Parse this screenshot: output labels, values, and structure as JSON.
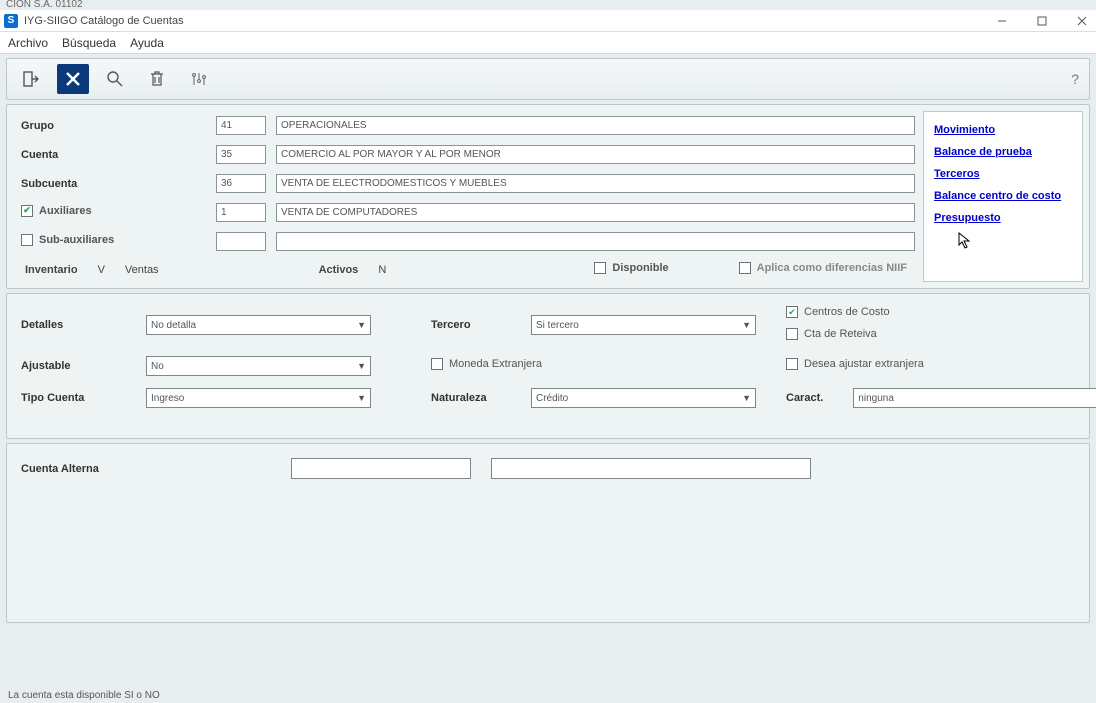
{
  "pre_title": "CION S.A.   01102",
  "window": {
    "title": "IYG-SIIGO  Catálogo de Cuentas"
  },
  "menu": {
    "archivo": "Archivo",
    "busqueda": "Búsqueda",
    "ayuda": "Ayuda"
  },
  "toolbar": {
    "help": "?"
  },
  "labels": {
    "grupo": "Grupo",
    "cuenta": "Cuenta",
    "subcuenta": "Subcuenta",
    "auxiliares": "Auxiliares",
    "subauxiliares": "Sub-auxiliares",
    "inventario": "Inventario",
    "ventas": "Ventas",
    "activos": "Activos",
    "disponible": "Disponible",
    "aplica_niif": "Aplica como diferencias NIIF",
    "detalles": "Detalles",
    "tercero": "Tercero",
    "ajustable": "Ajustable",
    "moneda_extranjera": "Moneda Extranjera",
    "tipo_cuenta": "Tipo Cuenta",
    "naturaleza": "Naturaleza",
    "caract": "Caract.",
    "centros_costo": "Centros de Costo",
    "cta_reteiva": "Cta de Reteiva",
    "desea_ajustar": "Desea ajustar extranjera",
    "cuenta_alterna": "Cuenta Alterna"
  },
  "codes": {
    "grupo": "41",
    "cuenta": "35",
    "subcuenta": "36",
    "aux": "1",
    "subaux": ""
  },
  "desc": {
    "grupo": "OPERACIONALES",
    "cuenta": "COMERCIO AL POR MAYOR Y AL  POR MENOR",
    "subcuenta": "VENTA DE ELECTRODOMESTICOS Y MUEBLES",
    "aux": "VENTA DE COMPUTADORES",
    "subaux": ""
  },
  "flags": {
    "inventario": "V",
    "activos": "N"
  },
  "links": {
    "movimiento": "Movimiento",
    "balance_prueba": "Balance de prueba",
    "terceros": "Terceros",
    "balance_centro": "Balance centro de costo",
    "presupuesto": "Presupuesto"
  },
  "selects": {
    "detalles": "No detalla",
    "tercero": "Si tercero",
    "ajustable": "No",
    "tipo_cuenta": "Ingreso",
    "naturaleza": "Crédito",
    "caract": "ninguna"
  },
  "status": "La cuenta esta disponible SI o NO"
}
